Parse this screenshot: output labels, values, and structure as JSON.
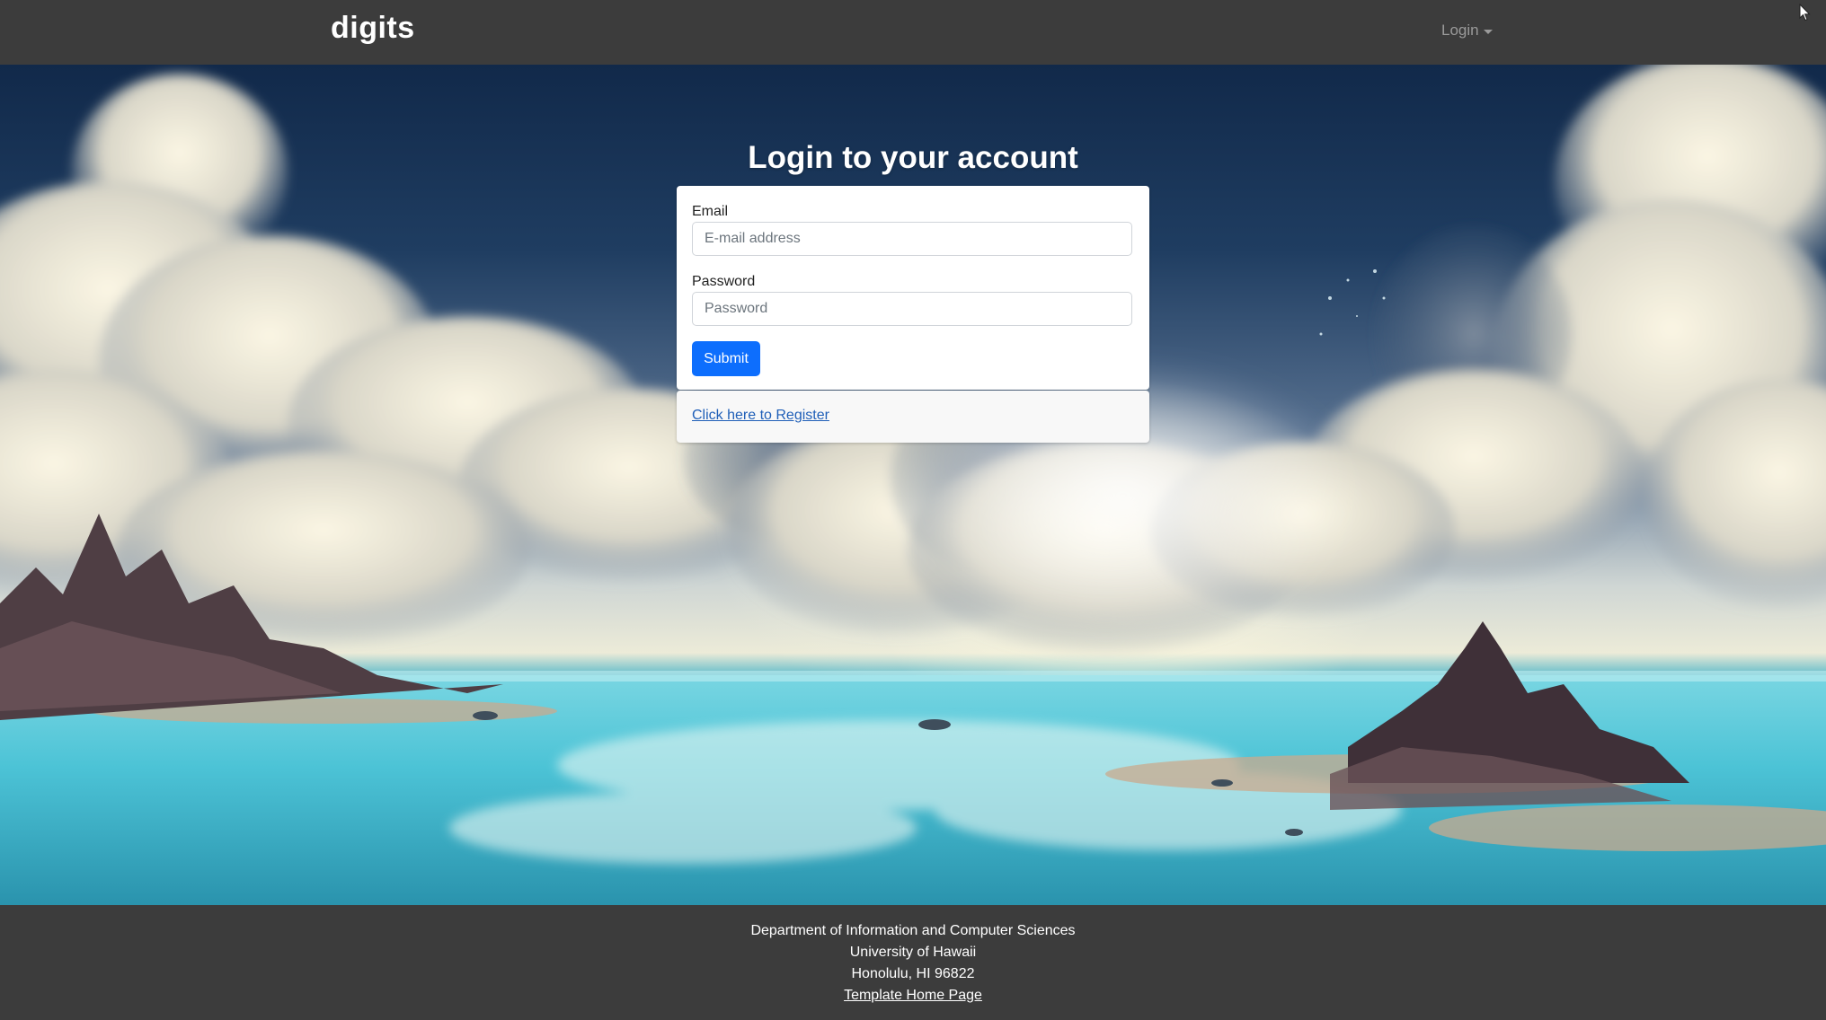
{
  "navbar": {
    "brand": "digits",
    "login_menu": "Login"
  },
  "login": {
    "title": "Login to your account",
    "email_label": "Email",
    "email_placeholder": "E-mail address",
    "email_value": "",
    "password_label": "Password",
    "password_placeholder": "Password",
    "password_value": "",
    "submit_label": "Submit",
    "register_link": "Click here to Register"
  },
  "footer": {
    "line1": "Department of Information and Computer Sciences",
    "line2": "University of Hawaii",
    "line3": "Honolulu, HI 96822",
    "link": "Template Home Page"
  },
  "colors": {
    "navbar_bg": "#3c3c3c",
    "primary": "#0d6efd",
    "link": "#1f5fb8"
  }
}
